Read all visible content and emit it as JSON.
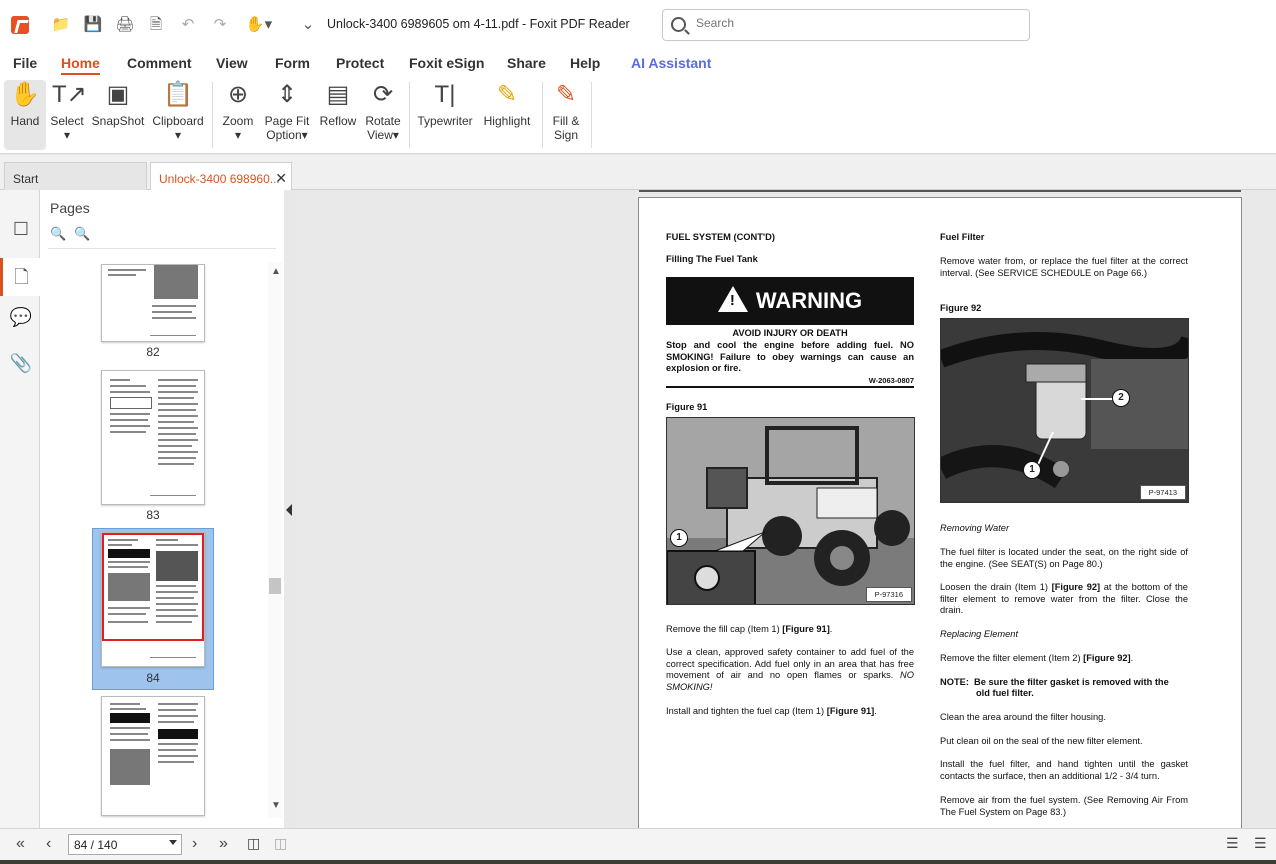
{
  "window": {
    "title": "Unlock-3400 6989605 om 4-11.pdf - Foxit PDF Reader"
  },
  "search": {
    "placeholder": "Search"
  },
  "menu": [
    "File",
    "Home",
    "Comment",
    "View",
    "Form",
    "Protect",
    "Foxit eSign",
    "Share",
    "Help",
    "AI Assistant"
  ],
  "ribbon": {
    "hand": "Hand",
    "select": "Select",
    "snapshot": "SnapShot",
    "clipboard": "Clipboard",
    "zoom": "Zoom",
    "pagefit1": "Page Fit",
    "pagefit2": "Option",
    "reflow": "Reflow",
    "rotate1": "Rotate",
    "rotate2": "View",
    "typewriter": "Typewriter",
    "highlight": "Highlight",
    "fill1": "Fill &",
    "fill2": "Sign"
  },
  "tabs": {
    "start": "Start",
    "doc": "Unlock-3400 698960..."
  },
  "pages_panel": {
    "title": "Pages",
    "thumbs": [
      "82",
      "83",
      "84"
    ]
  },
  "status": {
    "page": "84 / 140"
  },
  "doc": {
    "left": {
      "section": "FUEL SYSTEM (CONT'D)",
      "subsection": "Filling The Fuel Tank",
      "warning": "WARNING",
      "avoid": "AVOID INJURY OR DEATH",
      "warning_text": "Stop and cool the engine before adding fuel. NO SMOKING! Failure to obey warnings can cause an explosion or fire.",
      "warning_code": "W-2063-0807",
      "figure_label": "Figure 91",
      "figure_tag": "P-97316",
      "callout": "1",
      "p1_a": "Remove the fill cap (Item 1) ",
      "p1_b": "[Figure 91]",
      "p1_c": ".",
      "p2_a": "Use a clean, approved safety container to add fuel of the correct specification. Add fuel only in an area that has free movement of air and no open flames or sparks. ",
      "p2_b": "NO SMOKING!",
      "p3_a": "Install and tighten the fuel cap (Item 1) ",
      "p3_b": "[Figure 91]",
      "p3_c": "."
    },
    "right": {
      "heading": "Fuel Filter",
      "intro": "Remove water from, or replace the fuel filter at the correct interval. (See SERVICE SCHEDULE on Page 66.)",
      "figure_label": "Figure 92",
      "figure_tag": "P-97413",
      "callout1": "1",
      "callout2": "2",
      "removing": "Removing Water",
      "p1": "The fuel filter is located under the seat, on the right side of the engine. (See SEAT(S) on Page 80.)",
      "p2_a": "Loosen the drain (Item 1) ",
      "p2_b": "[Figure 92]",
      "p2_c": " at the bottom of the filter element to remove water from the filter. Close the drain.",
      "replacing": "Replacing Element",
      "p3_a": "Remove the filter element (Item 2) ",
      "p3_b": "[Figure 92]",
      "p3_c": ".",
      "note_label": "NOTE:",
      "note_a": "Be sure the filter gasket is removed with the",
      "note_b": "old fuel filter.",
      "p4": "Clean the area around the filter housing.",
      "p5": "Put clean oil on the seal of the new filter element.",
      "p6": "Install the fuel filter, and hand tighten until the gasket contacts the surface, then an additional 1/2 - 3/4 turn.",
      "p7": "Remove air from the fuel system. (See Removing Air From The Fuel System on Page 83.)"
    }
  }
}
